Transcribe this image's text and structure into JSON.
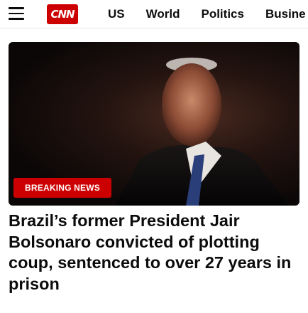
{
  "header": {
    "logo_text": "CNN",
    "nav": [
      {
        "label": "US"
      },
      {
        "label": "World"
      },
      {
        "label": "Politics"
      },
      {
        "label": "Busine"
      }
    ]
  },
  "hero": {
    "badge": "BREAKING NEWS"
  },
  "article": {
    "headline": "Brazil’s former President Jair Bolsonaro convicted of plotting coup, sentenced to over 27 years in prison"
  },
  "colors": {
    "brand_red": "#cc0000",
    "text": "#0c0c0c",
    "background": "#ffffff"
  },
  "icons": [
    "hamburger-menu-icon",
    "cnn-logo"
  ]
}
